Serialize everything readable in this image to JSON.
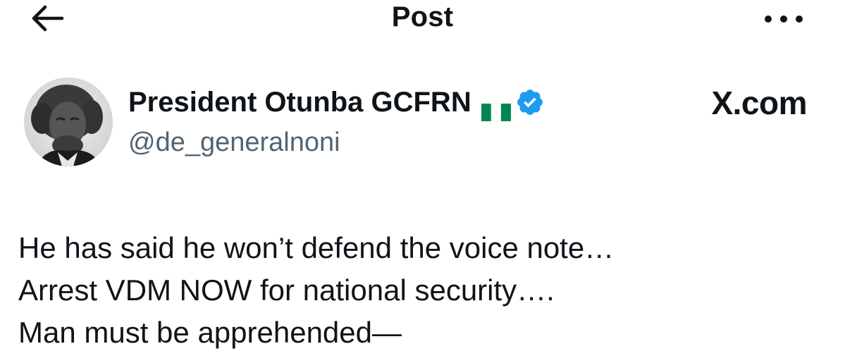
{
  "header": {
    "title": "Post",
    "back_icon": "arrow-left-icon",
    "more_icon": "more-horizontal-icon"
  },
  "author": {
    "display_name": "President Otunba GCFRN",
    "flag_icon": "nigeria-flag-icon",
    "verified_icon": "verified-badge-icon",
    "handle": "@de_generalnoni",
    "avatar_icon": "avatar-portrait"
  },
  "source_label": "X.com",
  "post": {
    "lines": [
      "He has said he won’t defend the voice note…",
      "Arrest VDM NOW for national security….",
      "Man must be apprehended—"
    ]
  },
  "colors": {
    "text": "#0f1419",
    "secondary_text": "#536471",
    "verified": "#1d9bf0",
    "flag_green": "#008751"
  }
}
